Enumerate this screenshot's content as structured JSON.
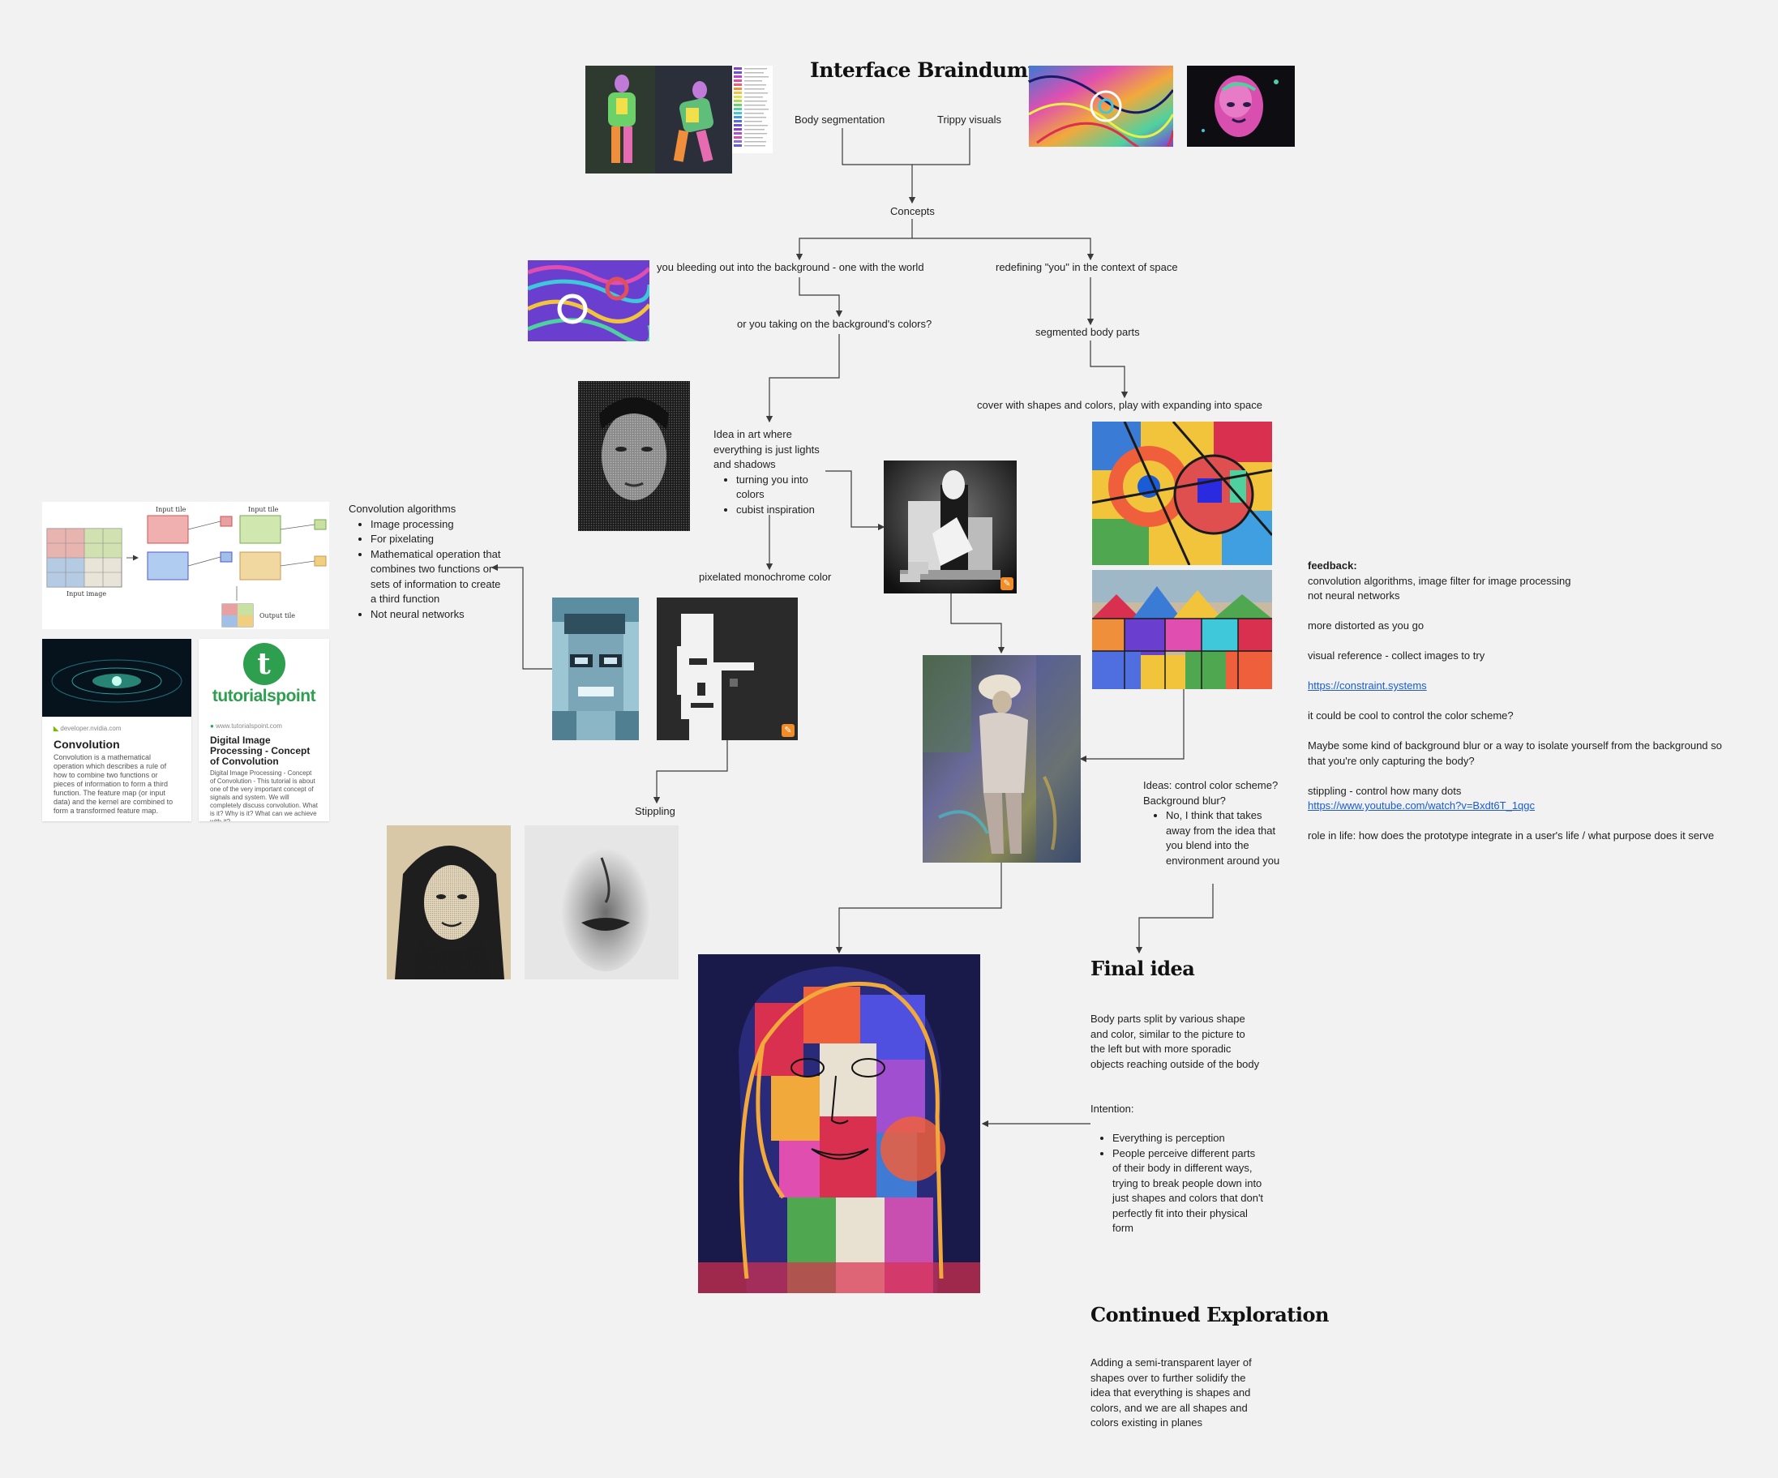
{
  "title": "Interface Braindump",
  "nodes": {
    "body_segmentation": "Body segmentation",
    "trippy_visuals": "Trippy visuals",
    "concepts": "Concepts",
    "bleeding": "you bleeding out into the background - one with the world",
    "redefining": "redefining \"you\" in the context of space",
    "taking_colors": "or you taking on the background's colors?",
    "segmented": "segmented body parts",
    "cover": "cover with shapes and colors, play with expanding into space",
    "pixelated": "pixelated monochrome color",
    "stippling": "Stippling"
  },
  "idea_art": {
    "intro": [
      "Idea in art where",
      "everything is just lights",
      "and shadows"
    ],
    "bullets": [
      "turning you into colors",
      "cubist inspiration"
    ]
  },
  "convolution": {
    "heading": "Convolution algorithms",
    "bullets": [
      "Image processing",
      "For pixelating",
      "Mathematical operation that combines two functions or sets of information to create a third function",
      "Not neural networks"
    ]
  },
  "ideas_control": {
    "lines": [
      "Ideas: control color scheme?",
      "Background blur?"
    ],
    "bullet": "No, I think that takes away from the idea that you blend into the environment around you"
  },
  "feedback": {
    "label": "feedback:",
    "line1": "convolution algorithms, image filter for image processing",
    "line2": "not neural networks",
    "distorted": "more distorted as you go",
    "visual_ref": "visual reference - collect images to try",
    "link1": "https://constraint.systems",
    "color_scheme": "it could be cool to control the color scheme?",
    "blur1": "Maybe some kind of background blur or a way to isolate yourself from the background so",
    "blur2": "that you're only capturing the body?",
    "stippling": "stippling - control how many dots",
    "link2": "https://www.youtube.com/watch?v=Bxdt6T_1qgc",
    "role": "role in life: how does the prototype integrate in a user's life / what purpose does it serve"
  },
  "final_idea": {
    "heading": "Final idea",
    "body": "Body parts split by various shape and color, similar to the picture to the left but with more sporadic objects reaching outside of the body",
    "intention_label": "Intention:",
    "bullets": [
      "Everything is perception",
      "People perceive different parts of their body in different ways, trying to break people down into just shapes and colors that don't perfectly fit into their physical form"
    ]
  },
  "continued": {
    "heading": "Continued Exploration",
    "body": "Adding a semi-transparent layer of shapes over to further solidify the idea that everything is shapes and colors, and we are all shapes and colors existing in planes"
  },
  "cards": {
    "nvidia": {
      "source": "developer.nvidia.com",
      "title": "Convolution",
      "desc": "Convolution is a mathematical operation which describes a rule of how to combine two functions or pieces of information to form a third function. The feature map (or input data) and the kernel are combined to form a transformed feature map."
    },
    "tutorialspoint": {
      "logo_text": "tutorialspoint",
      "source": "www.tutorialspoint.com",
      "title": "Digital Image Processing - Concept of Convolution",
      "desc": "Digital Image Processing - Concept of Convolution - This tutorial is about one of the very important concept of signals and system. We will completely discuss convolution. What is it? Why is it? What can we achieve with it?"
    }
  },
  "diagram_labels": {
    "input_tile_1": "Input tile",
    "input_tile_2": "Input tile",
    "input_image": "Input image",
    "output_tile": "Output tile"
  },
  "colors": {
    "background": "#f2f2f2",
    "text": "#1f1f1f",
    "link": "#1a5bd6",
    "connector": "#3a3a3a",
    "tutorials_green": "#2e9e4f"
  }
}
